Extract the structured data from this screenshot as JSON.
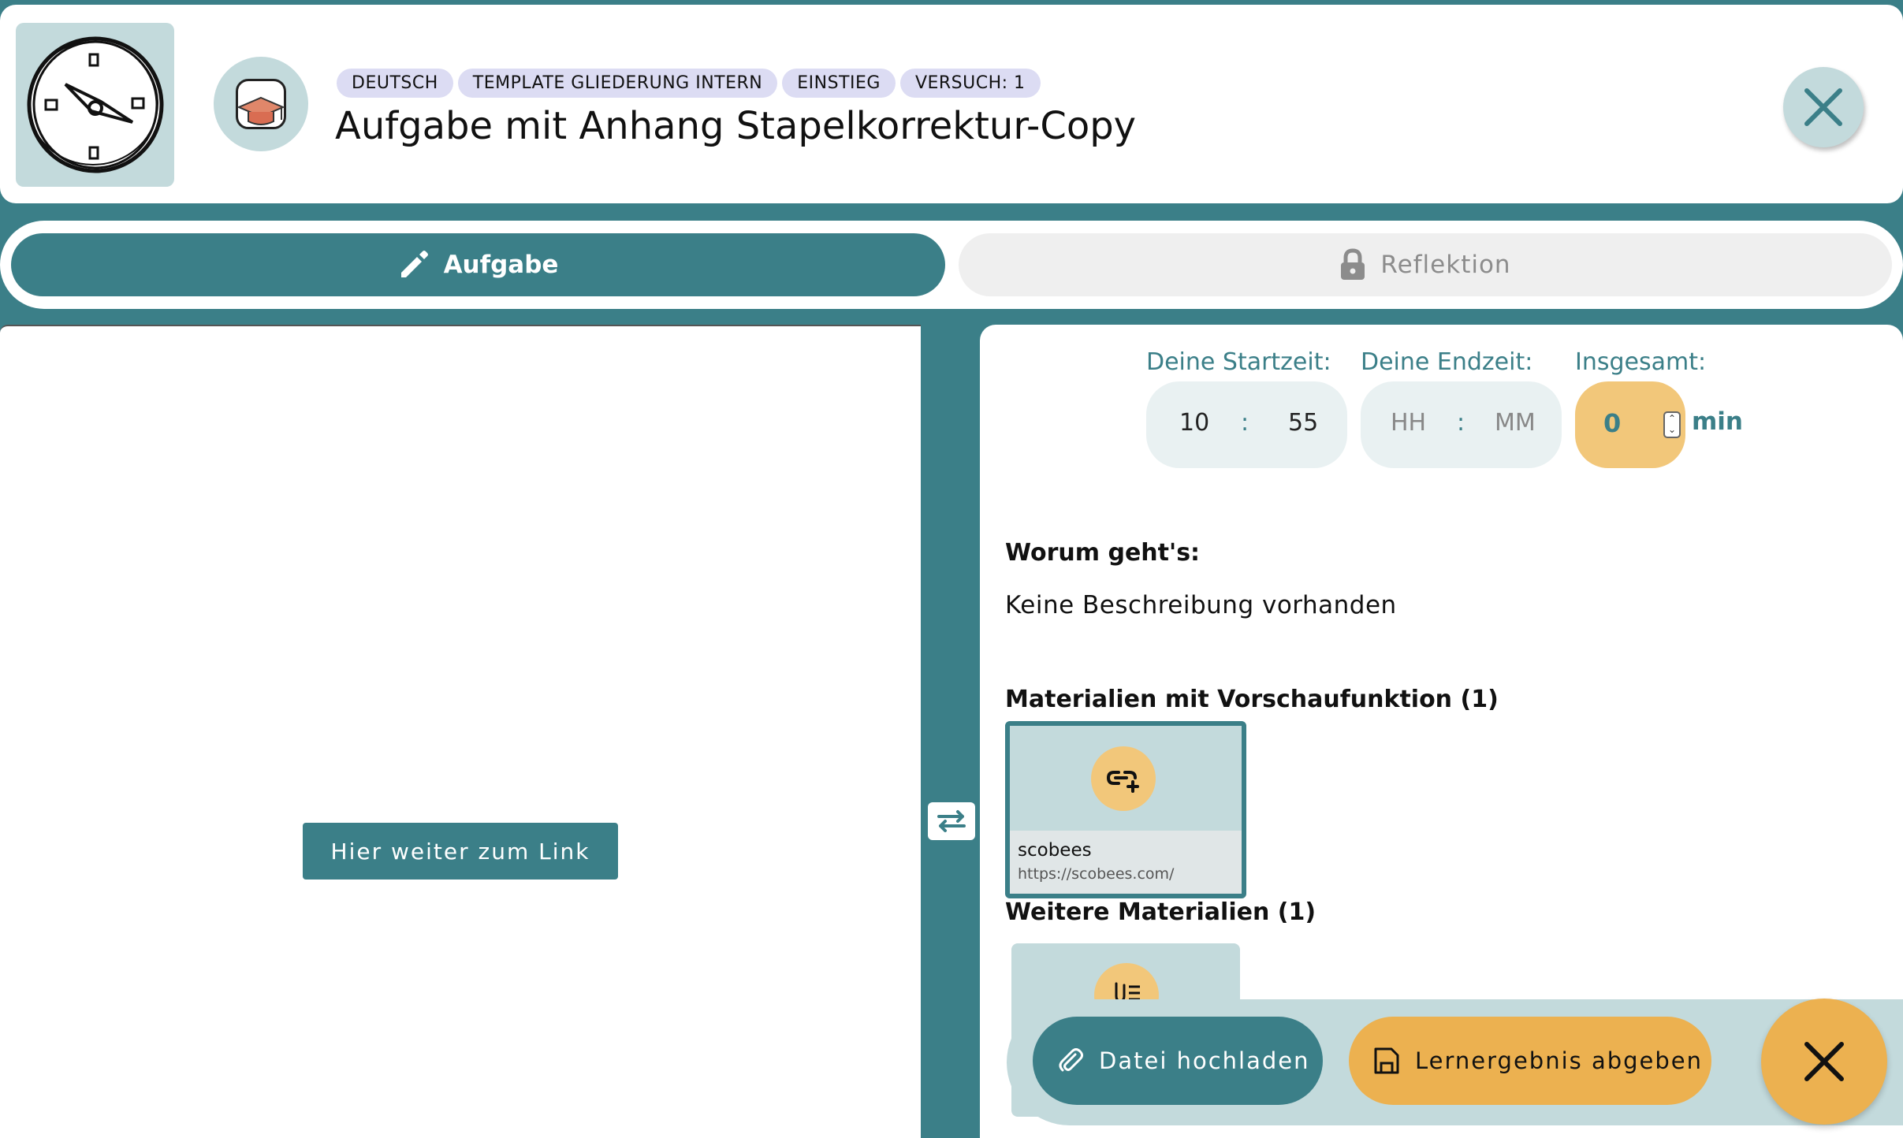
{
  "header": {
    "tags": [
      "DEUTSCH",
      "TEMPLATE GLIEDERUNG INTERN",
      "EINSTIEG",
      "VERSUCH: 1"
    ],
    "title": "Aufgabe mit Anhang Stapelkorrektur-Copy",
    "logo_icon": "compass-icon",
    "subject_icon": "graduation-cap-icon",
    "close_icon": "close-icon"
  },
  "tabs": {
    "aufgabe": {
      "label": "Aufgabe",
      "icon": "pencil-icon",
      "active": true
    },
    "reflektion": {
      "label": "Reflektion",
      "icon": "lock-icon",
      "active": false
    }
  },
  "left": {
    "link_button": "Hier weiter zum Link"
  },
  "time": {
    "start_label": "Deine Startzeit:",
    "start_hh": "10",
    "start_mm": "55",
    "end_label": "Deine Endzeit:",
    "end_hh_placeholder": "HH",
    "end_mm_placeholder": "MM",
    "separator": ":",
    "total_label": "Insgesamt:",
    "total_value": "0",
    "total_unit": "min"
  },
  "description": {
    "heading": "Worum geht's:",
    "text": "Keine Beschreibung vorhanden"
  },
  "materials_preview": {
    "heading": "Materialien mit Vorschaufunktion (1)",
    "items": [
      {
        "name": "scobees",
        "url": "https://scobees.com/",
        "icon": "add-link-icon"
      }
    ]
  },
  "materials_further": {
    "heading": "Weitere Materialien (1)",
    "icon": "attachment-document-icon"
  },
  "actions": {
    "upload_label": "Datei hochladen",
    "submit_label": "Lernergebnis abgeben"
  },
  "colors": {
    "teal": "#3b7f88",
    "light_teal": "#c3dadc",
    "orange": "#ecb150",
    "tag_bg": "#dcdcf3"
  }
}
